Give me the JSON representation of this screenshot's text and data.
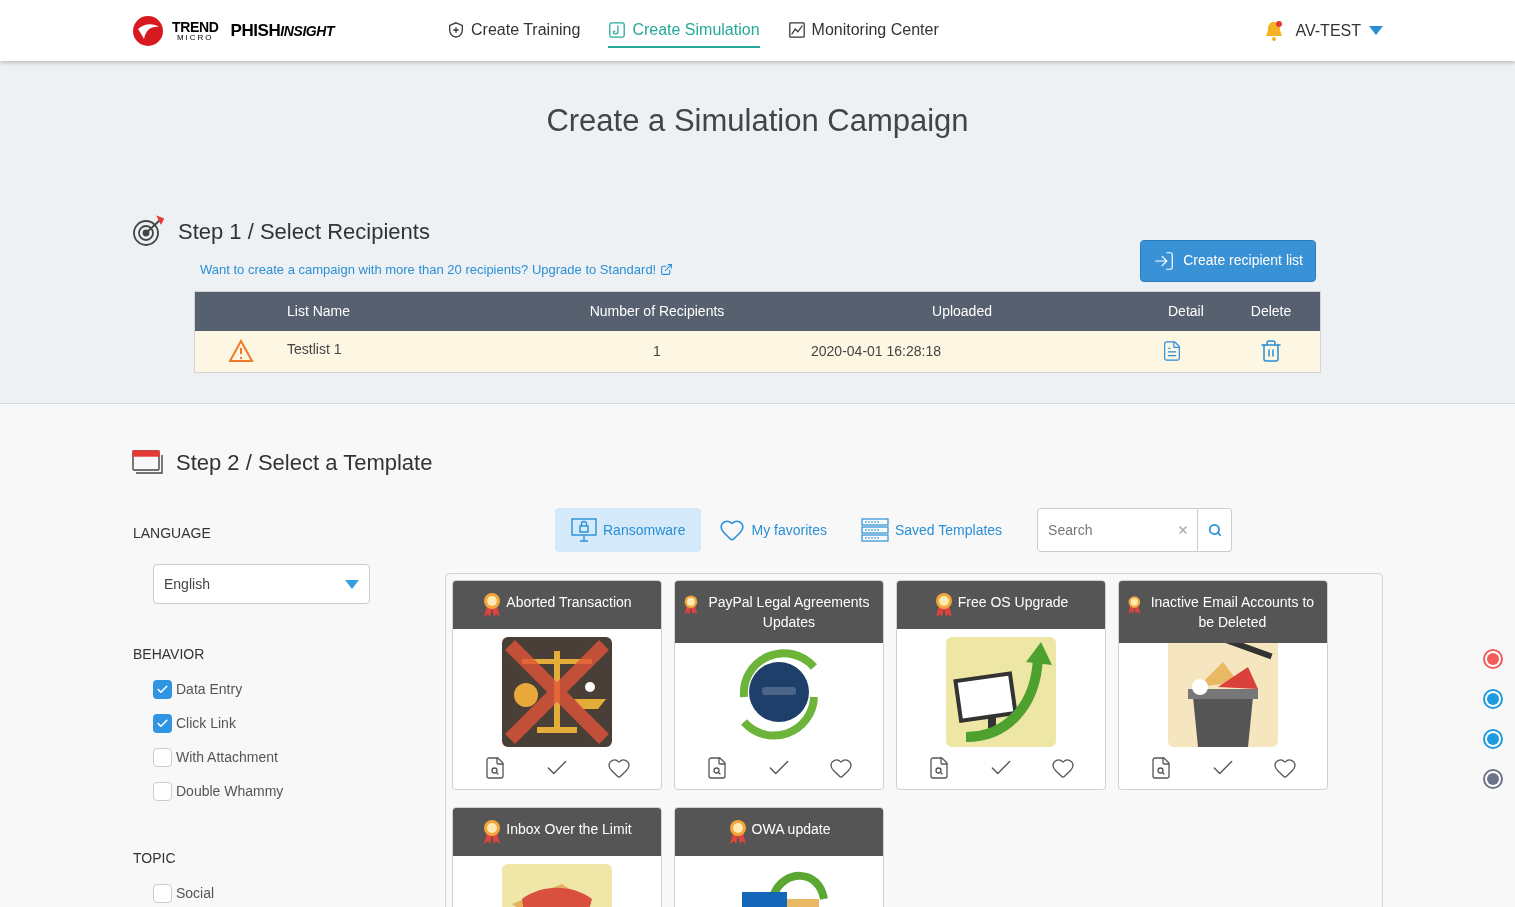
{
  "header": {
    "logo": {
      "brand": "TREND",
      "brand_sub": "MICRO",
      "product": "PHISH",
      "product_suffix": "INSIGHT"
    },
    "nav": [
      {
        "label": "Create Training",
        "selected": false
      },
      {
        "label": "Create Simulation",
        "selected": true
      },
      {
        "label": "Monitoring Center",
        "selected": false
      }
    ],
    "user": "AV-TEST"
  },
  "page_title": "Create a Simulation Campaign",
  "step1": {
    "title": "Step 1 / Select Recipients",
    "upgrade_link": "Want to create a campaign with more than 20 recipients? Upgrade to Standard!",
    "create_button": "Create recipient list",
    "table": {
      "columns": [
        "List Name",
        "Number of Recipients",
        "Uploaded",
        "Detail",
        "Delete"
      ],
      "rows": [
        {
          "warning": true,
          "list_name": "Testlist 1",
          "recipients": "1",
          "uploaded": "2020-04-01 16:28:18"
        }
      ]
    }
  },
  "step2": {
    "title": "Step 2 / Select a Template",
    "filters": [
      {
        "heading": "LANGUAGE",
        "kind": "select",
        "value": "English"
      },
      {
        "heading": "BEHAVIOR",
        "kind": "checkboxes",
        "options": [
          {
            "label": "Data Entry",
            "checked": true
          },
          {
            "label": "Click Link",
            "checked": true
          },
          {
            "label": "With Attachment",
            "checked": false
          },
          {
            "label": "Double Whammy",
            "checked": false
          }
        ]
      },
      {
        "heading": "TOPIC",
        "kind": "checkboxes",
        "options": [
          {
            "label": "Social",
            "checked": false
          }
        ]
      }
    ],
    "toolbar": [
      {
        "label": "Ransomware",
        "selected": true
      },
      {
        "label": "My favorites",
        "selected": false
      },
      {
        "label": "Saved Templates",
        "selected": false
      }
    ],
    "search": {
      "placeholder": "Search"
    },
    "templates": [
      {
        "title": "Aborted Transaction",
        "actions": true
      },
      {
        "title": "PayPal Legal Agreements Updates",
        "actions": true
      },
      {
        "title": "Free OS Upgrade",
        "actions": true
      },
      {
        "title": "Inactive Email Accounts to be Deleted",
        "actions": true
      },
      {
        "title": "Inbox Over the Limit"
      },
      {
        "title": "OWA update"
      }
    ]
  },
  "page_dots": [
    {
      "color": "#f25c5c"
    },
    {
      "color": "#1e9be0"
    },
    {
      "color": "#1e9be0"
    },
    {
      "color": "#6b7488"
    }
  ]
}
